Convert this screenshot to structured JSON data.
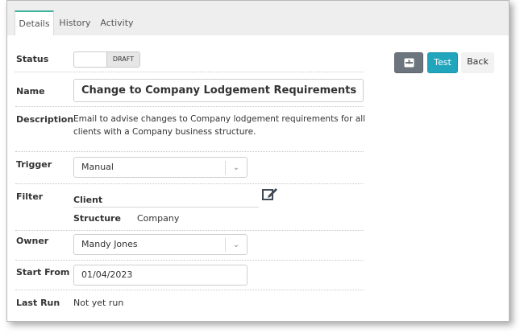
{
  "tabs": [
    {
      "label": "Details",
      "active": true
    },
    {
      "label": "History",
      "active": false
    },
    {
      "label": "Activity",
      "active": false
    }
  ],
  "form": {
    "status": {
      "label": "Status",
      "value": "DRAFT"
    },
    "name": {
      "label": "Name",
      "value": "Change to Company Lodgement Requirements"
    },
    "description": {
      "label": "Description",
      "line1": "Email to advise changes to Company lodgement requirements for all",
      "line2": "clients with a Company business structure."
    },
    "trigger": {
      "label": "Trigger",
      "value": "Manual"
    },
    "filter": {
      "label": "Filter",
      "group": "Client",
      "field": "Structure",
      "value": "Company"
    },
    "owner": {
      "label": "Owner",
      "value": "Mandy Jones"
    },
    "start_from": {
      "label": "Start From",
      "value": "01/04/2023"
    },
    "last_run": {
      "label": "Last Run",
      "value": "Not yet run"
    }
  },
  "actions": {
    "test_label": "Test",
    "back_label": "Back"
  },
  "colors": {
    "accent": "#20a5bd",
    "tab_accent": "#3eb39c",
    "save_button": "#6c757d"
  },
  "icons": {
    "save": "archive-icon",
    "edit": "edit-icon",
    "chevron": "chevron-down-icon"
  }
}
